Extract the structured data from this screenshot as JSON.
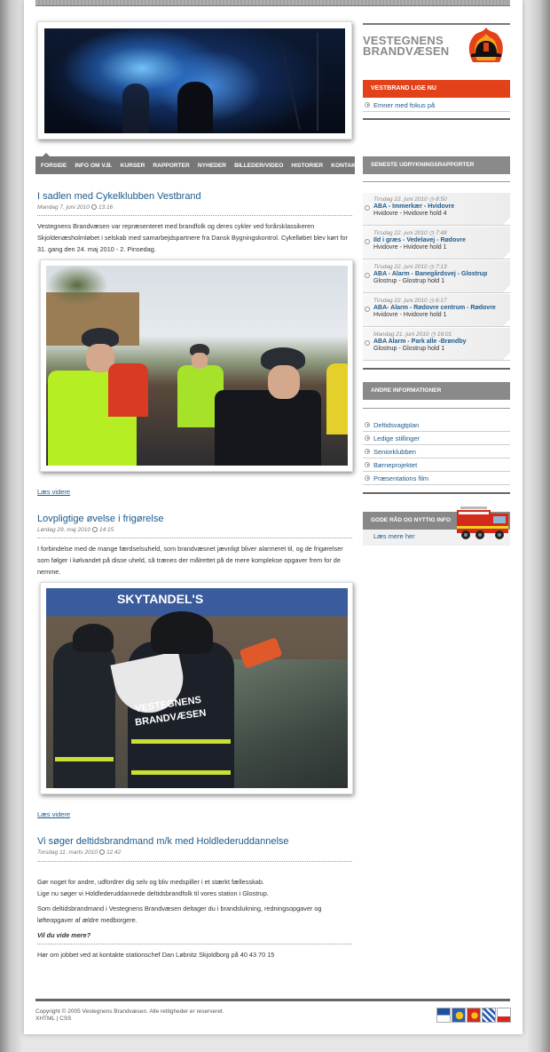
{
  "header": {
    "logo_line1": "VESTEGNENS",
    "logo_line2": "BRANDVÆSEN"
  },
  "sidebar_top": {
    "red_heading": "VESTBRAND LIGE NU",
    "link": "Emner med fokus på"
  },
  "nav": {
    "items": [
      "FORSIDE",
      "INFO OM V.B.",
      "KURSER",
      "RAPPORTER",
      "NYHEDER",
      "BILLEDER/VIDEO",
      "HISTORIER",
      "KONTAKT"
    ]
  },
  "reports": {
    "heading": "SENESTE UDRYKNINGSRAPPORTER",
    "items": [
      {
        "date": "Tirsdag 22. juni 2010",
        "time": "8:50",
        "title": "ABA - Immerkær - Hvidovre",
        "station": "Hvidovre - Hvidovre hold 4"
      },
      {
        "date": "Tirsdag 22. juni 2010",
        "time": "7:48",
        "title": "Ild i græs - Vedelavej - Rødovre",
        "station": "Hvidovre - Hvidovre hold 1"
      },
      {
        "date": "Tirsdag 22. juni 2010",
        "time": "7:13",
        "title": "ABA - Alarm - Banegårdsvej - Glostrup",
        "station": "Glostrup - Glostrup hold 1"
      },
      {
        "date": "Tirsdag 22. juni 2010",
        "time": "6:17",
        "title": "ABA- Alarm - Rødovre centrum - Rødovre",
        "station": "Hvidovre - Hvidovre hold 1"
      },
      {
        "date": "Mandag 21. juni 2010",
        "time": "16:01",
        "title": "ABA Alarm - Park alle -Brøndby",
        "station": "Glostrup - Glostrup hold 1"
      }
    ]
  },
  "info": {
    "heading": "ANDRE INFORMATIONER",
    "links": [
      "Deltidsvagtplan",
      "Ledige stillinger",
      "Seniorklubben",
      "Børneprojektet",
      "Præsentations film"
    ]
  },
  "promo": {
    "heading": "GODE RÅD OG NYTTIG INFO",
    "link": "Læs mere her"
  },
  "articles": [
    {
      "title": "I sadlen med Cykelklubben Vestbrand",
      "date": "Mandag 7. juni 2010",
      "time": "13:16",
      "body": "Vestegnens Brandvæsen var repræsenteret med brandfolk og deres cykler ved forårsklassikeren Skjoldenæsholmløbet i selskab med samarbejdspartnere fra Dansk Bygningskontrol. Cykelløbet blev kørt for 31. gang den 24. maj 2010 - 2. Pinsedag.",
      "read_more": "Læs videre"
    },
    {
      "title": "Lovpligtige øvelse i frigørelse",
      "date": "Lørdag 29. maj 2010",
      "time": "14:15",
      "body": "I forbindelse med de mange færdselsuheld, som brandvæsnet jævnligt bliver alarmeret til, og de frigørelser som følger i kølvandet på disse uheld, så trænes der målrettet på de mere komplekse opgaver frem for de nemme.",
      "photo_text_1": "VESTEGNENS",
      "photo_text_2": "BRANDVÆSEN",
      "photo_sign": "SKYTANDEL'S",
      "read_more": "Læs videre"
    },
    {
      "title": "Vi søger deltidsbrandmand m/k med Holdlederuddannelse",
      "date": "Torsdag 11. marts 2010",
      "time": "12:42",
      "p1": "Gør noget for andre, udfordrer dig selv og bliv medspiller i et stærkt fællesskab.",
      "p2": "Lige nu søger vi Holdlederuddannede deltidsbrandfolk til vores station i Glostrup.",
      "p3": "Som deltidsbrandmand i Vestegnens Brandvæsen deltager du i brandslukning, redningsopgaver og løfteopgaver af ældre medborgere.",
      "p4": "Vil du vide mere?",
      "p5": "Hør om jobbet ved at kontakte stationschef Dan Løbnitz Skjoldborg på 40 43 70 15"
    }
  ],
  "footer": {
    "copyright": "Copyright © 2005 Vestegnens Brandvæsen. Alle rettigheder er reserveret.",
    "link_xhtml": "XHTML",
    "separator": "|",
    "link_css": "CSS"
  },
  "colors": {
    "accent_red": "#e2411a",
    "link_blue": "#1d5a8c",
    "nav_grey": "#777777"
  }
}
